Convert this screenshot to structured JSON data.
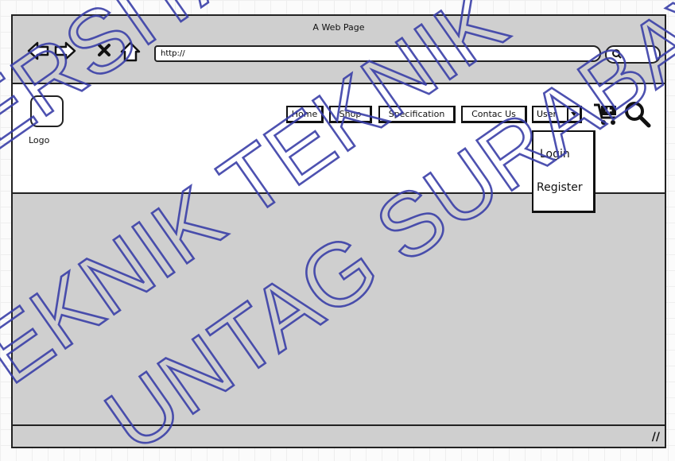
{
  "window": {
    "title": "A Web Page"
  },
  "toolbar": {
    "back_icon": "back-arrow-icon",
    "forward_icon": "forward-arrow-icon",
    "stop_icon": "close-x-icon",
    "home_icon": "home-icon",
    "url": "http://",
    "search_icon": "search-icon"
  },
  "header": {
    "logo_label": "Logo",
    "nav": [
      {
        "label": "Home"
      },
      {
        "label": "Shop"
      },
      {
        "label": "Specification"
      },
      {
        "label": "Contac Us"
      }
    ],
    "user_dropdown": {
      "label": "User",
      "options": [
        "Login",
        "Register"
      ]
    },
    "cart_icon": "cart-plus-icon",
    "search_icon": "magnifier-icon"
  },
  "watermark": {
    "lines": [
      "ERSITAS",
      "TEKNIK TEKNIK",
      "UNTAG SURABAYA"
    ],
    "color": "#3a3fa8"
  },
  "statusbar": {
    "grip_icon": "resize-grip-icon"
  }
}
